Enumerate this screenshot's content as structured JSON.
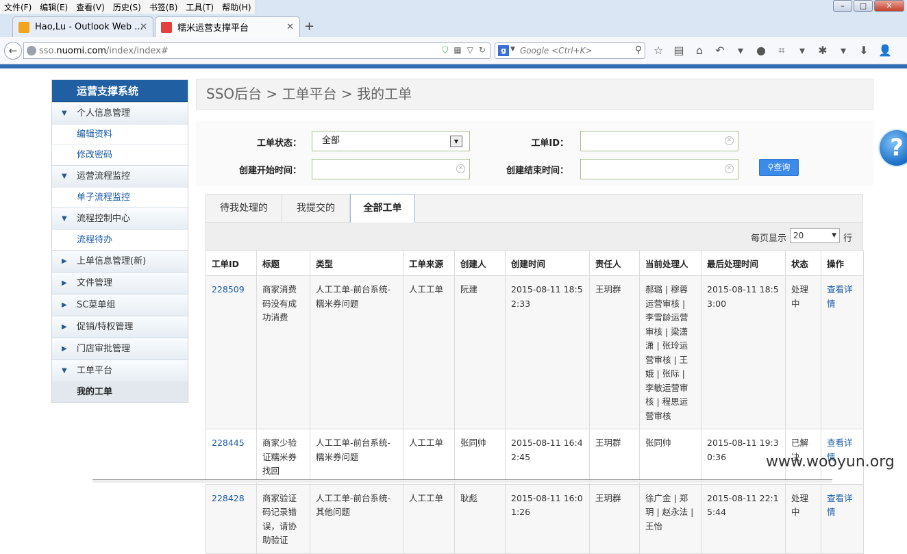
{
  "browser": {
    "menus": [
      "文件(F)",
      "编辑(E)",
      "查看(V)",
      "历史(S)",
      "书签(B)",
      "工具(T)",
      "帮助(H)"
    ],
    "tabs": [
      {
        "label": "Hao,Lu - Outlook Web ...",
        "icon": "outlook-icon",
        "color": "#f2a51a"
      },
      {
        "label": "糯米运营支撑平台",
        "icon": "nuomi-icon",
        "color": "#e2413d"
      }
    ],
    "url_prefix": "sso.",
    "url_domain": "nuomi.com",
    "url_path": "/index/index#",
    "search_placeholder": "Google <Ctrl+K>"
  },
  "sidebar": {
    "title": "运营支撑系统",
    "items": [
      {
        "type": "group",
        "label": "个人信息管理",
        "expanded": true
      },
      {
        "type": "sub",
        "label": "编辑资料"
      },
      {
        "type": "sub",
        "label": "修改密码"
      },
      {
        "type": "group",
        "label": "运营流程监控",
        "expanded": true
      },
      {
        "type": "sub",
        "label": "单子流程监控"
      },
      {
        "type": "group",
        "label": "流程控制中心",
        "expanded": true
      },
      {
        "type": "sub",
        "label": "流程待办"
      },
      {
        "type": "group",
        "label": "上单信息管理(新)",
        "expanded": false
      },
      {
        "type": "group",
        "label": "文件管理",
        "expanded": false
      },
      {
        "type": "group",
        "label": "SC菜单组",
        "expanded": false
      },
      {
        "type": "group",
        "label": "促销/特权管理",
        "expanded": false
      },
      {
        "type": "group",
        "label": "门店审批管理",
        "expanded": false
      },
      {
        "type": "group",
        "label": "工单平台",
        "expanded": true
      },
      {
        "type": "sub",
        "label": "我的工单",
        "active": true
      }
    ]
  },
  "breadcrumb": "SSO后台 > 工单平台 > 我的工单",
  "filter": {
    "status_label": "工单状态：",
    "status_value": "全部",
    "id_label": "工单ID：",
    "start_label": "创建开始时间：",
    "end_label": "创建结束时间：",
    "query_label": "查询"
  },
  "tabs": [
    {
      "label": "待我处理的",
      "active": false
    },
    {
      "label": "我提交的",
      "active": false
    },
    {
      "label": "全部工单",
      "active": true
    }
  ],
  "pager": {
    "label": "每页显示",
    "value": "20",
    "unit": "行"
  },
  "table": {
    "columns": [
      "工单ID",
      "标题",
      "类型",
      "工单来源",
      "创建人",
      "创建时间",
      "责任人",
      "当前处理人",
      "最后处理时间",
      "状态",
      "操作"
    ],
    "rows": [
      [
        "228509",
        "商家消费码没有成功消费",
        "人工工单-前台系统-糯米券问题",
        "人工工单",
        "阮建",
        "2015-08-11 18:52:33",
        "王玥群",
        "郝璐 | 穆蓉运营审核 | 李雪龄运营审核 | 梁潇潇 | 张玲运营审核 | 王娥 | 张际 | 李敏运营审核 | 程思运营审核",
        "2015-08-11 18:53:00",
        "处理中",
        "查看详情"
      ],
      [
        "228445",
        "商家少验证糯米券找回",
        "人工工单-前台系统-糯米券问题",
        "人工工单",
        "张同帅",
        "2015-08-11 16:42:45",
        "王玥群",
        "张同帅",
        "2015-08-11 19:30:36",
        "已解决",
        "查看详情"
      ],
      [
        "228428",
        "商家验证码记录错误，请协助验证",
        "人工工单-前台系统-其他问题",
        "人工工单",
        "耿彪",
        "2015-08-11 16:01:26",
        "王玥群",
        "徐广金 | 郑玥 | 赵永法 | 王怡",
        "2015-08-11 22:15:44",
        "处理中",
        "查看详情"
      ]
    ]
  },
  "watermark": "www.wooyun.org"
}
